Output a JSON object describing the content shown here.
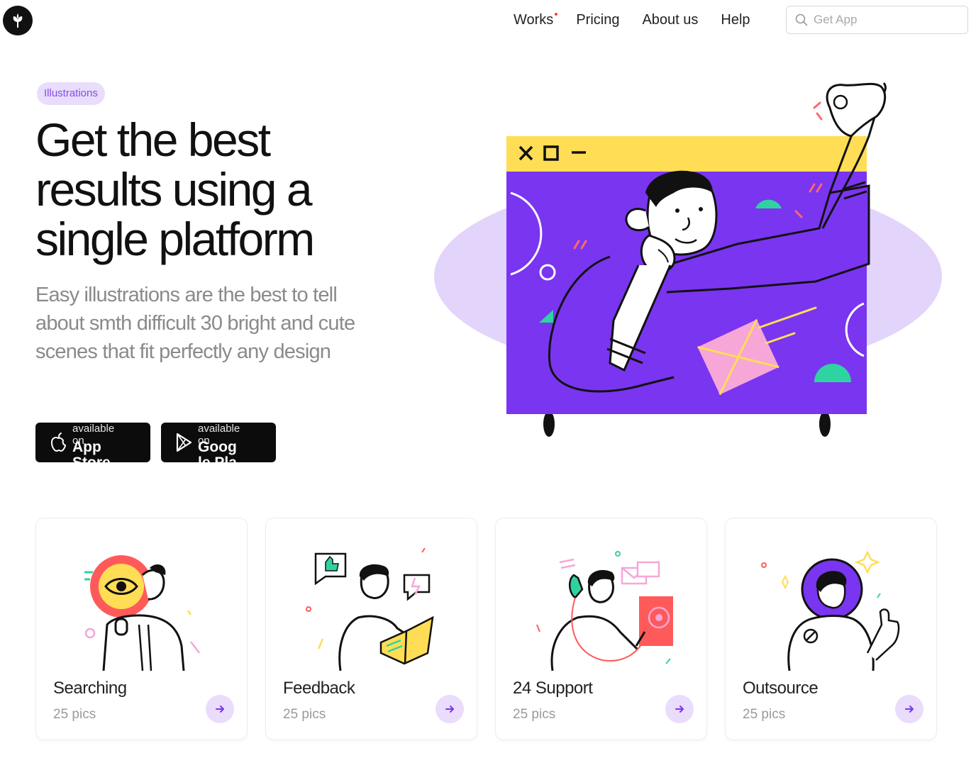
{
  "nav": {
    "items": [
      {
        "label": "Works",
        "has_dot": true
      },
      {
        "label": "Pricing",
        "has_dot": false
      },
      {
        "label": "About us",
        "has_dot": false
      },
      {
        "label": "Help",
        "has_dot": false
      }
    ],
    "search_placeholder": "Get App"
  },
  "hero": {
    "badge": "Illustrations",
    "title": "Get the best results using a single platform",
    "subtitle": "Easy illustrations are the best to tell about smth difficult 30 bright and cute scenes that fit perfectly any design",
    "stores": [
      {
        "small": "available on",
        "big": "App Store",
        "icon": "apple-icon"
      },
      {
        "small": "available on",
        "big": "Google Play",
        "icon": "play-icon"
      }
    ]
  },
  "cards": [
    {
      "title": "Searching",
      "count": "25 pics"
    },
    {
      "title": "Feedback",
      "count": "25 pics"
    },
    {
      "title": "24 Support",
      "count": "25 pics"
    },
    {
      "title": "Outsource",
      "count": "25 pics"
    }
  ],
  "colors": {
    "accent_purple": "#7a35f0",
    "accent_lilac": "#e3d4fb",
    "badge_text": "#8a4be8",
    "yellow": "#ffdd55",
    "mint": "#2ed3a0",
    "pink": "#f7a6d8",
    "coral": "#ff5a5a"
  }
}
